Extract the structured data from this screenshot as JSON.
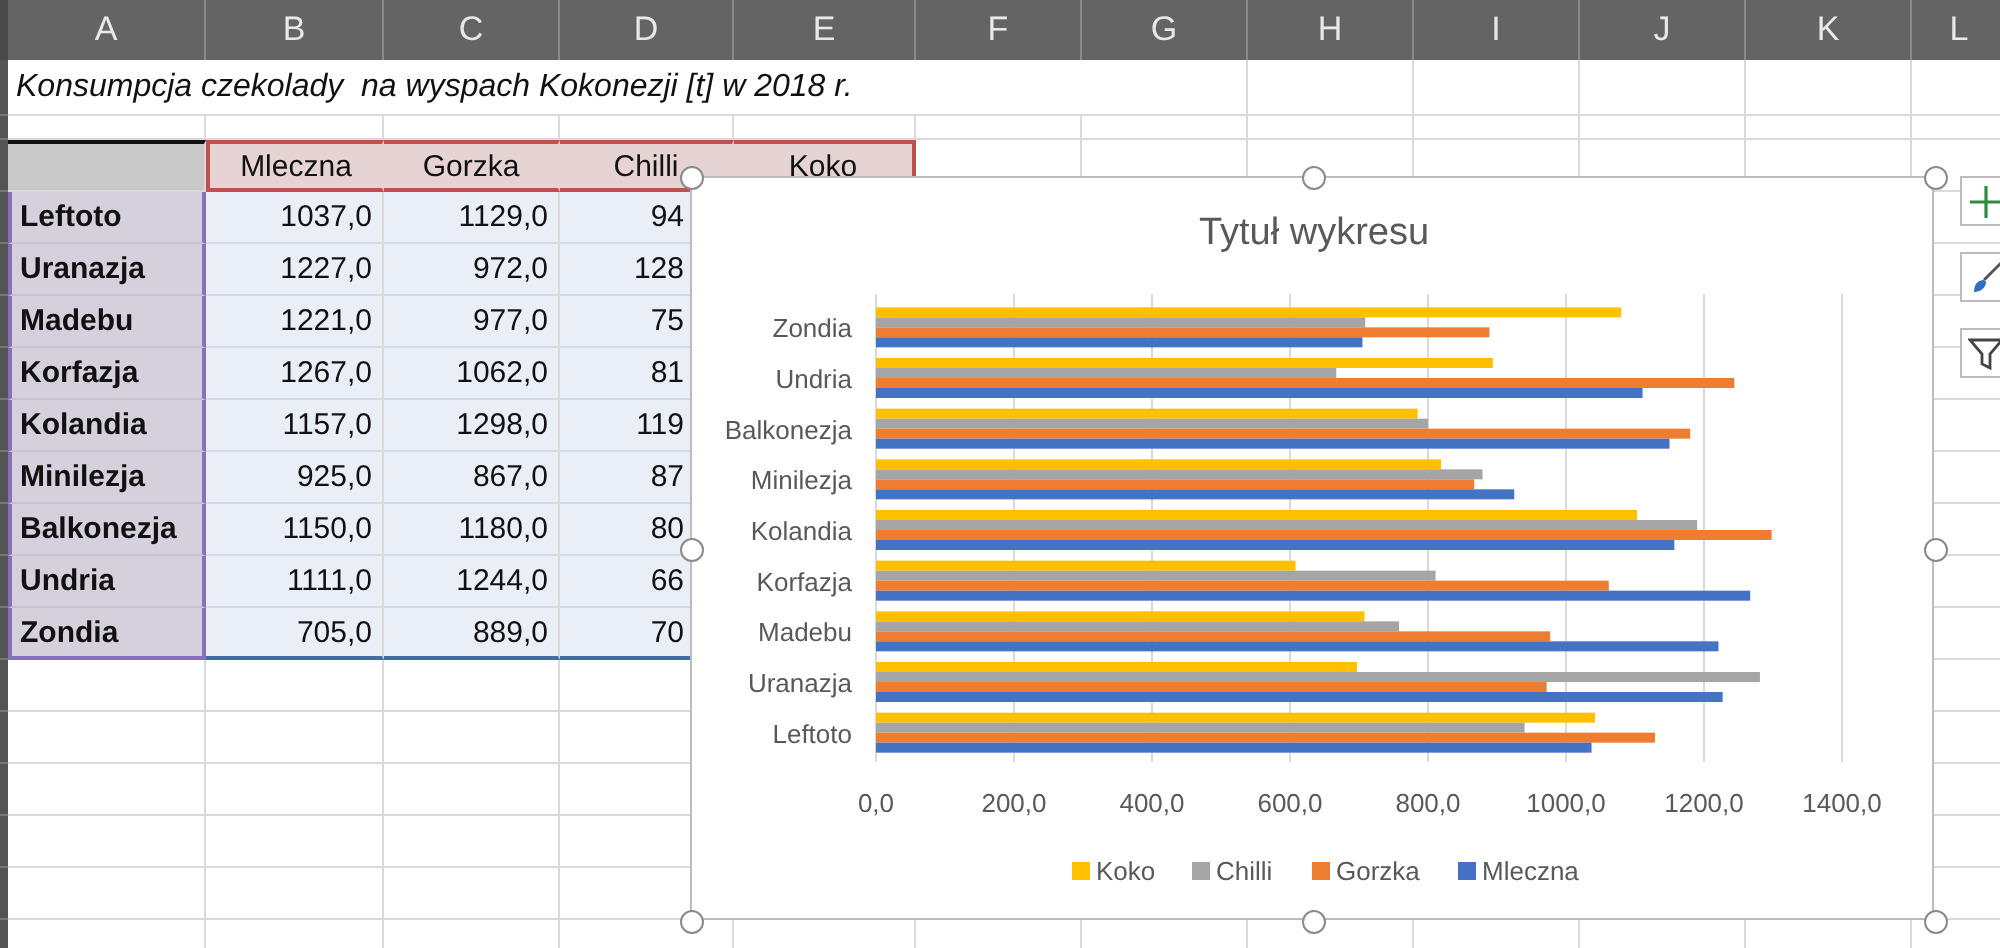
{
  "columns": [
    "A",
    "B",
    "C",
    "D",
    "E",
    "F",
    "G",
    "H",
    "I",
    "J",
    "K",
    "L"
  ],
  "title": "Konsumpcja czekolady  na wyspach Kokonezji [t] w 2018 r.",
  "table": {
    "headers": [
      "Mleczna",
      "Gorzka",
      "Chilli",
      "Koko"
    ],
    "rows": [
      {
        "name": "Leftoto",
        "cells": [
          "1037,0",
          "1129,0",
          "94"
        ]
      },
      {
        "name": "Uranazja",
        "cells": [
          "1227,0",
          "972,0",
          "128"
        ]
      },
      {
        "name": "Madebu",
        "cells": [
          "1221,0",
          "977,0",
          "75"
        ]
      },
      {
        "name": "Korfazja",
        "cells": [
          "1267,0",
          "1062,0",
          "81"
        ]
      },
      {
        "name": "Kolandia",
        "cells": [
          "1157,0",
          "1298,0",
          "119"
        ]
      },
      {
        "name": "Minilezja",
        "cells": [
          "925,0",
          "867,0",
          "87"
        ]
      },
      {
        "name": "Balkonezja",
        "cells": [
          "1150,0",
          "1180,0",
          "80"
        ]
      },
      {
        "name": "Undria",
        "cells": [
          "1111,0",
          "1244,0",
          "66"
        ]
      },
      {
        "name": "Zondia",
        "cells": [
          "705,0",
          "889,0",
          "70"
        ]
      }
    ]
  },
  "chart": {
    "chart_data": {
      "type": "bar",
      "orientation": "horizontal",
      "title": "Tytuł wykresu",
      "categories": [
        "Zondia",
        "Undria",
        "Balkonezja",
        "Minilezja",
        "Kolandia",
        "Korfazja",
        "Madebu",
        "Uranazja",
        "Leftoto"
      ],
      "series": [
        {
          "name": "Koko",
          "color": "#ffc000",
          "values": [
            1080,
            894,
            785,
            819,
            1103,
            608,
            708,
            697,
            1042
          ]
        },
        {
          "name": "Chilli",
          "color": "#a5a5a5",
          "values": [
            709,
            667,
            800,
            879,
            1190,
            811,
            758,
            1281,
            940
          ]
        },
        {
          "name": "Gorzka",
          "color": "#ed7d31",
          "values": [
            889,
            1244,
            1180,
            867,
            1298,
            1062,
            977,
            972,
            1129
          ]
        },
        {
          "name": "Mleczna",
          "color": "#4472c4",
          "values": [
            705,
            1111,
            1150,
            925,
            1157,
            1267,
            1221,
            1227,
            1037
          ]
        }
      ],
      "xlim": [
        0,
        1400
      ],
      "xticks": [
        {
          "value": 0,
          "label": "0,0"
        },
        {
          "value": 200,
          "label": "200,0"
        },
        {
          "value": 400,
          "label": "400,0"
        },
        {
          "value": 600,
          "label": "600,0"
        },
        {
          "value": 800,
          "label": "800,0"
        },
        {
          "value": 1000,
          "label": "1000,0"
        },
        {
          "value": 1200,
          "label": "1200,0"
        },
        {
          "value": 1400,
          "label": "1400,0"
        }
      ],
      "grid": true,
      "legend": true
    }
  }
}
